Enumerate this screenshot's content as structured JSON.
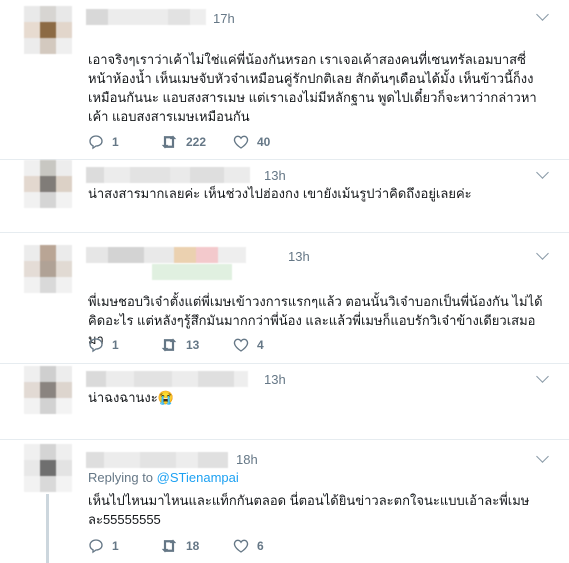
{
  "replies": [
    {
      "time": "17h",
      "text": "เอาจริงๆเราว่าเค้าไม่ใช่แค่พี่น้องกันหรอก เราเจอเค้าสองคนที่เซนทรัลเอมบาสซี่ หน้าห้องน้ำ เห็นเมษจับหัวจ๋าเหมือนคู่รักปกติเลย สักต้นๆเดือนได้มั้ง เห็นข้าวนี้ก็งงเหมือนกันนะ แอบสงสารเมษ แต่เราเองไม่มีหลักฐาน พูดไปเดี๋ยวก็จะหาว่ากล่าวหาเค้า แอบสงสารเมษเหมือนกัน",
      "replies_count": "1",
      "retweets": "222",
      "likes": "40"
    },
    {
      "time": "13h",
      "text": "น่าสงสารมากเลยค่ะ เห็นช่วงไปฮ่องกง เขายังเม้นรูปว่าคิดถึงอยู่เลยค่ะ"
    },
    {
      "time": "13h",
      "text": "พี่เมษชอบวิเจ๋าตั้งแต่พี่เมษเข้าวงการแรกๆแล้ว ตอนนั้นวิเจ๋าบอกเป็นพี่น้องกัน ไม่ได้คิดอะไร แต่หลังๆรู้สึกมันมากกว่าพี่น้อง และแล้วพี่เมษก็แอบรักวิเจ๋าข้างเดียวเสมอมา",
      "replies_count": "1",
      "retweets": "13",
      "likes": "4"
    },
    {
      "time": "13h",
      "text": "น่าฉงฉานงะ😭"
    },
    {
      "time": "18h",
      "replying_prefix": "Replying to",
      "replying_handle": "@STienampai",
      "text": "เห็นไปไหนมาไหนและแท็กกันตลอด นี่ตอนได้ยินข่าวละตกใจนะแบบเอ้าละพี่เมษละ55555555",
      "replies_count": "1",
      "retweets": "18",
      "likes": "6"
    }
  ],
  "icons": [
    "reply-icon",
    "retweet-icon",
    "like-icon",
    "chevron-down-icon"
  ],
  "colors": {
    "meta": "#657786",
    "link": "#1da1f2",
    "thread": "#ccd6dd",
    "separator": "#e6ecf0"
  }
}
